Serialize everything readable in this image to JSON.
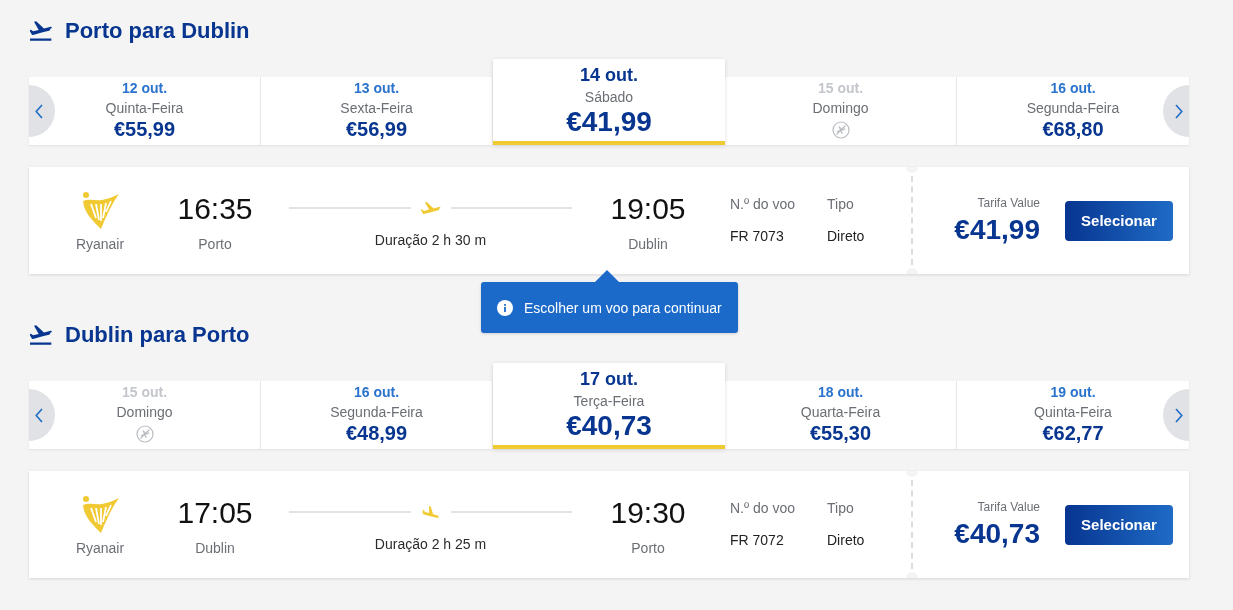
{
  "sections": [
    {
      "title": "Porto para Dublin",
      "dates": [
        {
          "date": "12 out.",
          "day": "Quinta-Feira",
          "price": "€55,99",
          "selected": false,
          "disabled": false
        },
        {
          "date": "13 out.",
          "day": "Sexta-Feira",
          "price": "€56,99",
          "selected": false,
          "disabled": false
        },
        {
          "date": "14 out.",
          "day": "Sábado",
          "price": "€41,99",
          "selected": true,
          "disabled": false
        },
        {
          "date": "15 out.",
          "day": "Domingo",
          "selected": false,
          "disabled": true
        },
        {
          "date": "16 out.",
          "day": "Segunda-Feira",
          "price": "€68,80",
          "selected": false,
          "disabled": false
        }
      ],
      "flight": {
        "airline": "Ryanair",
        "departure_time": "16:35",
        "departure_city": "Porto",
        "duration": "Duração 2 h 30 m",
        "arrival_time": "19:05",
        "arrival_city": "Dublin",
        "flight_number_label": "N.º do voo",
        "flight_number": "FR 7073",
        "type_label": "Tipo",
        "type": "Direto",
        "fare_label": "Tarifa Value",
        "fare": "€41,99",
        "button": "Selecionar"
      },
      "tooltip": {
        "text": "Escolher um voo para continuar"
      }
    },
    {
      "title": "Dublin para Porto",
      "dates": [
        {
          "date": "15 out.",
          "day": "Domingo",
          "selected": false,
          "disabled": true
        },
        {
          "date": "16 out.",
          "day": "Segunda-Feira",
          "price": "€48,99",
          "selected": false,
          "disabled": false
        },
        {
          "date": "17 out.",
          "day": "Terça-Feira",
          "price": "€40,73",
          "selected": true,
          "disabled": false
        },
        {
          "date": "18 out.",
          "day": "Quarta-Feira",
          "price": "€55,30",
          "selected": false,
          "disabled": false
        },
        {
          "date": "19 out.",
          "day": "Quinta-Feira",
          "price": "€62,77",
          "selected": false,
          "disabled": false
        }
      ],
      "flight": {
        "airline": "Ryanair",
        "departure_time": "17:05",
        "departure_city": "Dublin",
        "duration": "Duração 2 h 25 m",
        "arrival_time": "19:30",
        "arrival_city": "Porto",
        "flight_number_label": "N.º do voo",
        "flight_number": "FR 7072",
        "type_label": "Tipo",
        "type": "Direto",
        "fare_label": "Tarifa Value",
        "fare": "€40,73",
        "button": "Selecionar"
      }
    }
  ]
}
